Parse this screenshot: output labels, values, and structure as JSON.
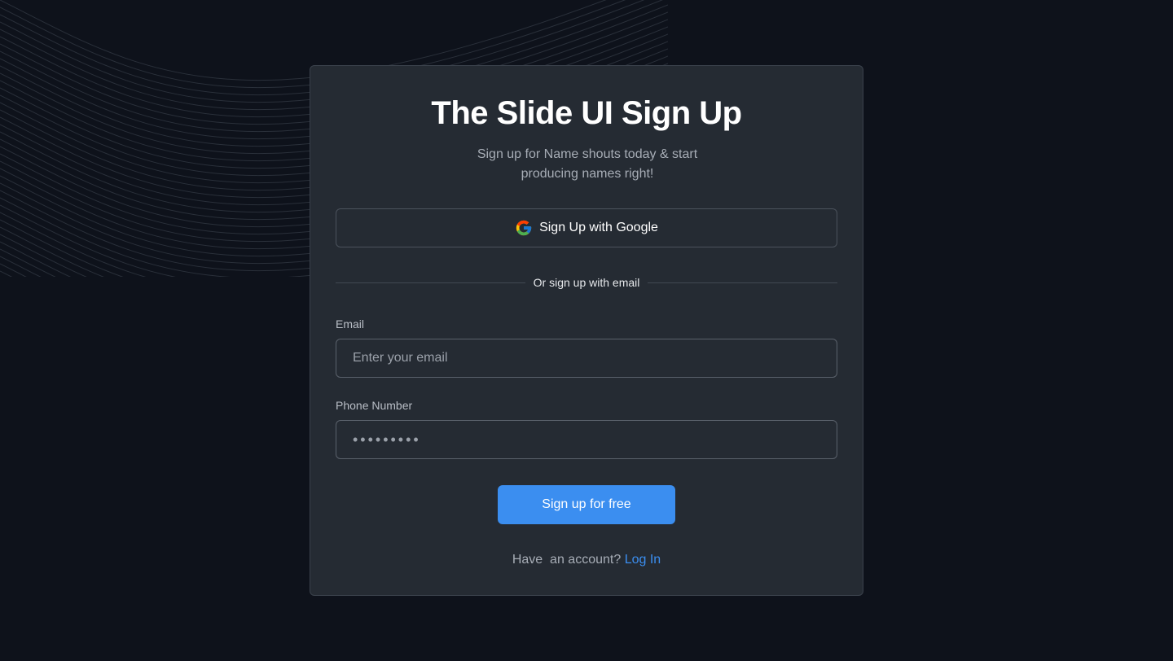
{
  "page": {
    "title": "The Slide UI Sign Up",
    "subtitle": "Sign up for Name shouts today & start producing names right!"
  },
  "google_button": {
    "label": "Sign Up with Google",
    "icon": "google-icon"
  },
  "divider": {
    "text": "Or sign up with email"
  },
  "form": {
    "email": {
      "label": "Email",
      "placeholder": "Enter your email",
      "value": ""
    },
    "phone": {
      "label": "Phone Number",
      "value": "•••••••••"
    },
    "submit_label": "Sign up for free"
  },
  "footer": {
    "prompt": "Have  an account? ",
    "link_label": "Log In"
  },
  "colors": {
    "background": "#0e121b",
    "card": "#252b33",
    "accent": "#3b8ef0"
  }
}
